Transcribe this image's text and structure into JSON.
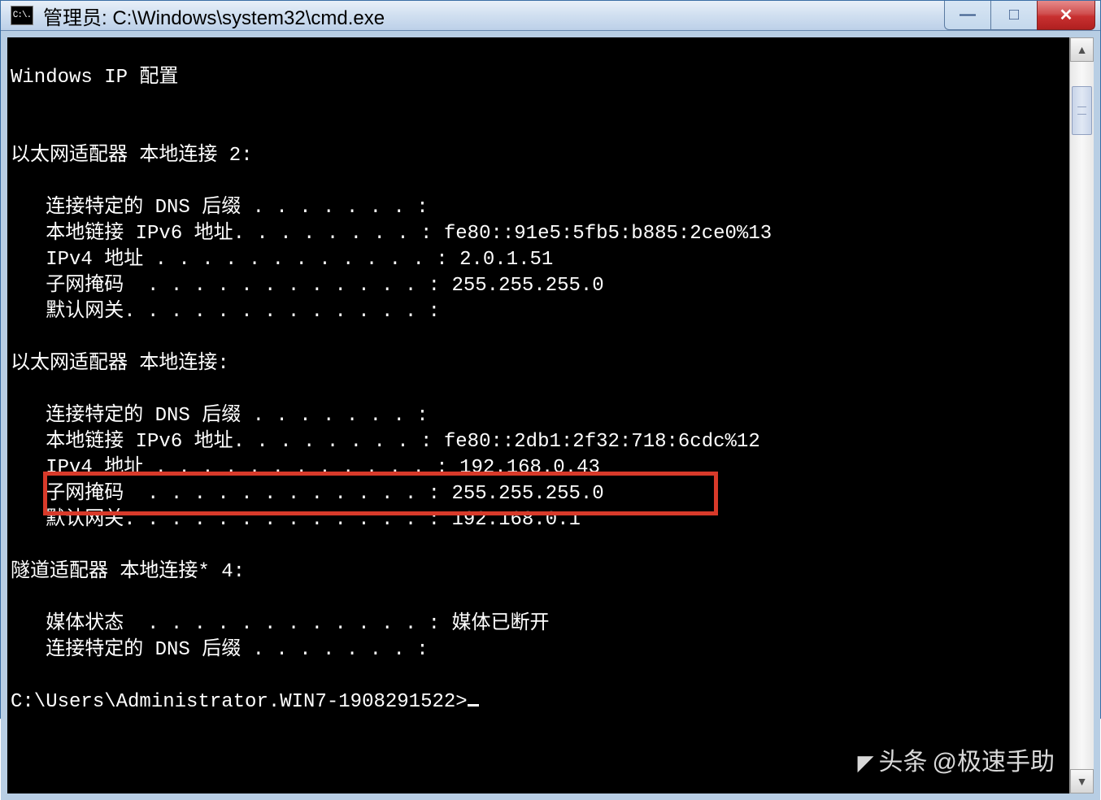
{
  "window": {
    "icon_text": "C:\\.",
    "title": "管理员: C:\\Windows\\system32\\cmd.exe"
  },
  "controls": {
    "minimize": "—",
    "maximize": "□",
    "close": "✕"
  },
  "console": {
    "header": "Windows IP 配置",
    "adapter1": {
      "title": "以太网适配器 本地连接 2:",
      "dns_suffix": "   连接特定的 DNS 后缀 . . . . . . . :",
      "ipv6": "   本地链接 IPv6 地址. . . . . . . . : fe80::91e5:5fb5:b885:2ce0%13",
      "ipv4": "   IPv4 地址 . . . . . . . . . . . . : 2.0.1.51",
      "subnet": "   子网掩码  . . . . . . . . . . . . : 255.255.255.0",
      "gateway": "   默认网关. . . . . . . . . . . . . :"
    },
    "adapter2": {
      "title": "以太网适配器 本地连接:",
      "dns_suffix": "   连接特定的 DNS 后缀 . . . . . . . :",
      "ipv6": "   本地链接 IPv6 地址. . . . . . . . : fe80::2db1:2f32:718:6cdc%12",
      "ipv4": "   IPv4 地址 . . . . . . . . . . . . : 192.168.0.43",
      "subnet": "   子网掩码  . . . . . . . . . . . . : 255.255.255.0",
      "gateway": "   默认网关. . . . . . . . . . . . . : 192.168.0.1"
    },
    "tunnel": {
      "title": "隧道适配器 本地连接* 4:",
      "media": "   媒体状态  . . . . . . . . . . . . : 媒体已断开",
      "dns_suffix": "   连接特定的 DNS 后缀 . . . . . . . :"
    },
    "prompt": "C:\\Users\\Administrator.WIN7-1908291522>"
  },
  "watermark": {
    "prefix": "头条",
    "text": "@极速手助"
  }
}
